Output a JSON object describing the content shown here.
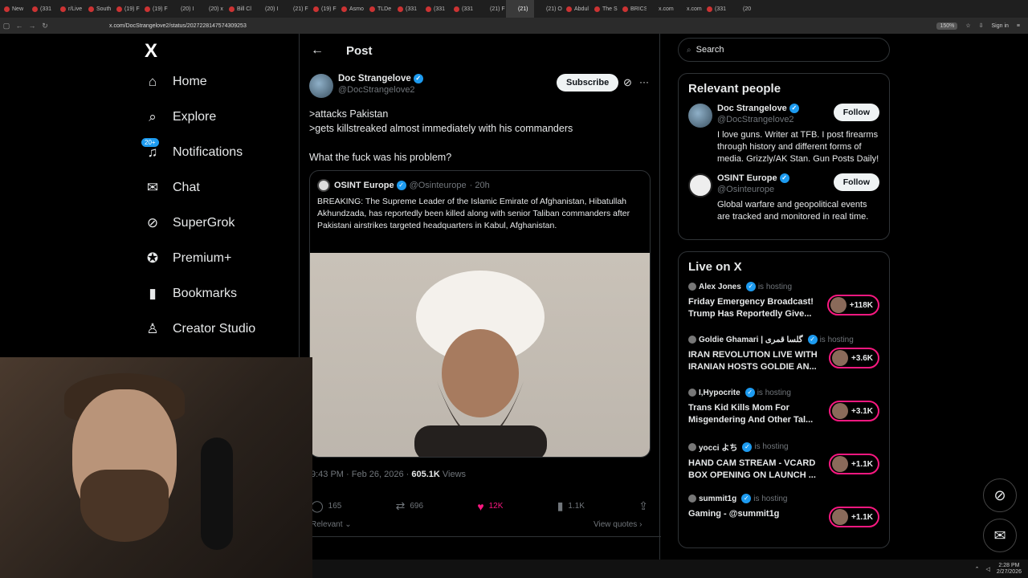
{
  "browser": {
    "tabs": [
      "New",
      "(331",
      "r/Live",
      "South",
      "(19) F",
      "(19) F",
      "(20) I",
      "(20) x",
      "Bill Cl",
      "(20) I",
      "(21) F",
      "(19) F",
      "Asmo",
      "TLDe",
      "(331",
      "(331",
      "(331",
      "(21) F",
      "(21)",
      "(21) O",
      "Abdul",
      "The S",
      "BRICS",
      "x.com",
      "x.com",
      "(331",
      "(20"
    ],
    "active_tab_index": 18,
    "url": "x.com/DocStrangelove2/status/2027228147574309253",
    "zoom": "150%",
    "sign_in": "Sign in"
  },
  "leftnav": {
    "logo": "X",
    "items": [
      {
        "label": "Home",
        "icon": "⌂"
      },
      {
        "label": "Explore",
        "icon": "⌕"
      },
      {
        "label": "Notifications",
        "icon": "♫"
      },
      {
        "label": "Chat",
        "icon": "✉"
      },
      {
        "label": "SuperGrok",
        "icon": "⊘"
      },
      {
        "label": "Premium+",
        "icon": "✪"
      },
      {
        "label": "Bookmarks",
        "icon": "▮"
      },
      {
        "label": "Creator Studio",
        "icon": "♙"
      }
    ],
    "notif_badge": "20+"
  },
  "post": {
    "header": "Post",
    "back": "←",
    "author_name": "Doc Strangelove",
    "author_handle": "@DocStrangelove2",
    "subscribe": "Subscribe",
    "lines": [
      ">attacks Pakistan",
      ">gets killstreaked almost immediately with his commanders",
      "",
      "What the fuck was his problem?"
    ],
    "quote": {
      "name": "OSINT Europe",
      "handle": "@Osinteurope",
      "time": "· 20h",
      "text": "BREAKING: The Supreme Leader of the Islamic Emirate of Afghanistan, Hibatullah Akhundzada, has reportedly been killed along with senior Taliban commanders after Pakistani airstrikes targeted headquarters in Kabul, Afghanistan."
    },
    "timestamp": "9:43 PM · Feb 26, 2026 ·",
    "views_count": "605.1K",
    "views_label": "Views",
    "actions": [
      {
        "icon": "◯",
        "count": "165"
      },
      {
        "icon": "⇄",
        "count": "696"
      },
      {
        "icon": "♥",
        "count": "12K"
      },
      {
        "icon": "▮",
        "count": "1.1K"
      },
      {
        "icon": "⇪",
        "count": ""
      }
    ],
    "relevant": "Relevant",
    "view_quotes": "View quotes"
  },
  "right": {
    "search_placeholder": "Search",
    "relevant_title": "Relevant people",
    "people": [
      {
        "name": "Doc Strangelove",
        "handle": "@DocStrangelove2",
        "bio": "I love guns. Writer at TFB. I post firearms through history and different forms of media. Grizzly/AK Stan. Gun Posts Daily!",
        "follow": "Follow"
      },
      {
        "name": "OSINT Europe",
        "handle": "@Osinteurope",
        "bio": "Global warfare and geopolitical events are tracked and monitored in real time.",
        "follow": "Follow"
      }
    ],
    "live_title": "Live on X",
    "live": [
      {
        "host": "Alex Jones",
        "hosting": "is hosting",
        "title": "Friday Emergency Broadcast! Trump Has Reportedly Give...",
        "count": "+118K"
      },
      {
        "host": "Goldie Ghamari | گلسا قمری",
        "hosting": "is hosting",
        "title": "IRAN REVOLUTION LIVE WITH IRANIAN HOSTS GOLDIE AN...",
        "count": "+3.6K"
      },
      {
        "host": "I,Hypocrite",
        "hosting": "is hosting",
        "title": "Trans Kid Kills Mom For Misgendering And Other Tal...",
        "count": "+3.1K"
      },
      {
        "host": "yocci よち",
        "hosting": "is hosting",
        "title": "HAND CAM STREAM - VCARD BOX OPENING ON LAUNCH ...",
        "count": "+1.1K"
      },
      {
        "host": "summit1g",
        "hosting": "is hosting",
        "title": "Gaming - @summit1g",
        "count": "+1.1K"
      }
    ]
  },
  "taskbar": {
    "time": "2:28 PM",
    "date": "2/27/2026"
  }
}
